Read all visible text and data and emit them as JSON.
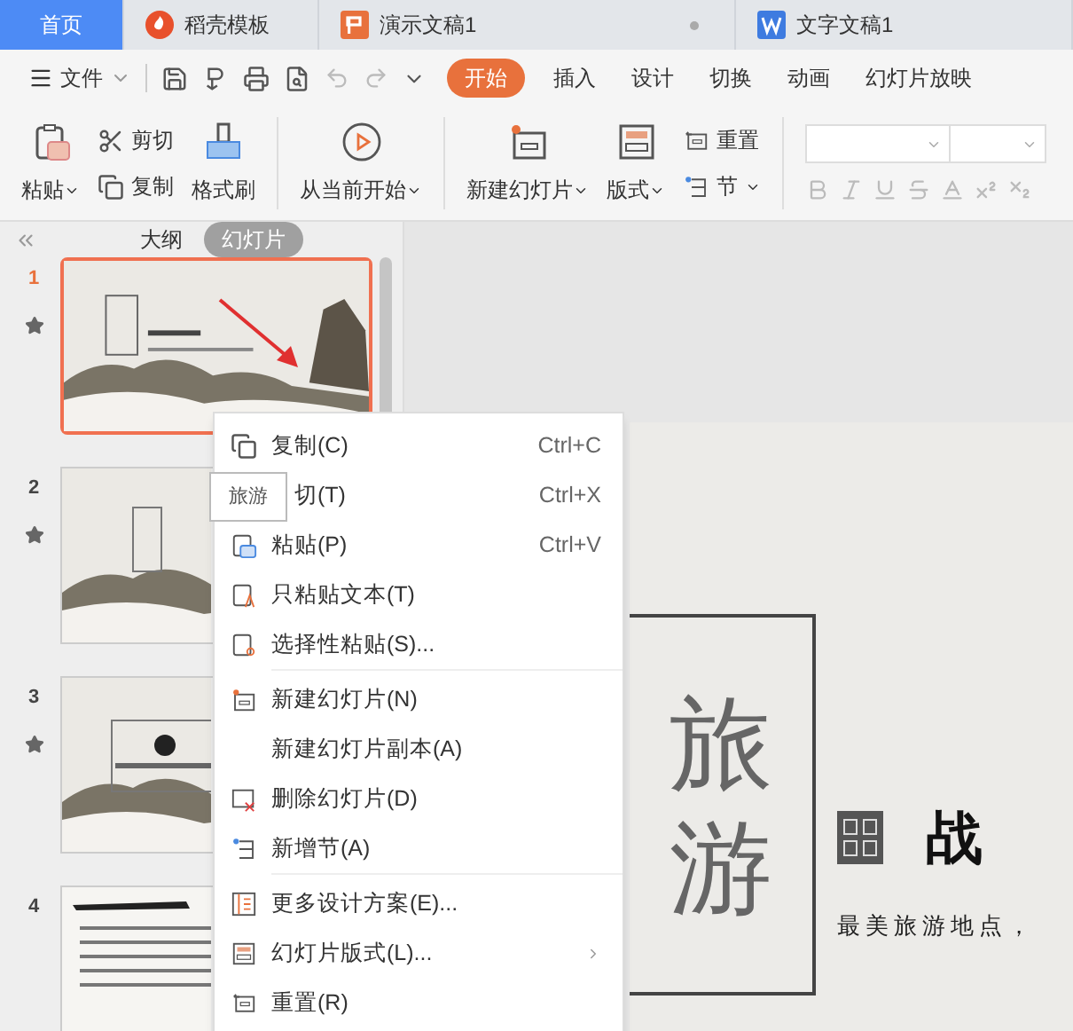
{
  "doc_tabs": [
    {
      "label": "首页",
      "selected": true,
      "kind": "home"
    },
    {
      "label": "稻壳模板",
      "selected": false,
      "kind": "template"
    },
    {
      "label": "演示文稿1",
      "selected": false,
      "kind": "presentation",
      "unsaved": true
    },
    {
      "label": "文字文稿1",
      "selected": false,
      "kind": "writer"
    }
  ],
  "file_menu": {
    "label": "文件"
  },
  "ribbon_tabs": [
    {
      "label": "开始",
      "selected": true
    },
    {
      "label": "插入",
      "selected": false
    },
    {
      "label": "设计",
      "selected": false
    },
    {
      "label": "切换",
      "selected": false
    },
    {
      "label": "动画",
      "selected": false
    },
    {
      "label": "幻灯片放映",
      "selected": false
    }
  ],
  "ribbon_groups": [
    [
      {
        "label": "粘贴",
        "kind": "paste",
        "dropdown": true
      },
      {
        "label": "剪切",
        "kind": "cut",
        "dropdown": false
      },
      {
        "label": "复制",
        "kind": "copy",
        "dropdown": false
      },
      {
        "label": "格式刷",
        "kind": "brush",
        "dropdown": false
      }
    ],
    [
      {
        "label": "从当前开始",
        "kind": "play",
        "dropdown": true
      }
    ],
    [
      {
        "label": "新建幻灯片",
        "kind": "newslide",
        "dropdown": true
      },
      {
        "label": "版式",
        "kind": "layout",
        "dropdown": true
      },
      {
        "label": "重置",
        "kind": "reset",
        "dropdown": false
      },
      {
        "label": "节",
        "kind": "section",
        "dropdown": true
      }
    ]
  ],
  "panel": {
    "tabs": [
      {
        "label": "大纲",
        "selected": false
      },
      {
        "label": "幻灯片",
        "selected": true
      }
    ]
  },
  "slides": [
    {
      "number": "1",
      "selected": true,
      "starred": true,
      "kind": "title"
    },
    {
      "number": "2",
      "selected": false,
      "starred": true,
      "kind": "contents"
    },
    {
      "number": "3",
      "selected": false,
      "starred": true,
      "kind": "section"
    },
    {
      "number": "4",
      "selected": false,
      "starred": false,
      "kind": "text"
    }
  ],
  "context_menu": {
    "groups": [
      [
        {
          "label": "复制(C)",
          "shortcut": "Ctrl+C",
          "kind": "copy"
        },
        {
          "label": "切(T)",
          "shortcut": "Ctrl+X",
          "kind": "covered"
        },
        {
          "label": "粘贴(P)",
          "shortcut": "Ctrl+V",
          "kind": "paste"
        },
        {
          "label": "只粘贴文本(T)",
          "kind": "pastetext"
        },
        {
          "label": "选择性粘贴(S)...",
          "kind": "pastespecial"
        }
      ],
      [
        {
          "label": "新建幻灯片(N)",
          "kind": "newslide"
        },
        {
          "label": "新建幻灯片副本(A)",
          "kind": "none"
        },
        {
          "label": "删除幻灯片(D)",
          "kind": "delete"
        },
        {
          "label": "新增节(A)",
          "kind": "section"
        }
      ],
      [
        {
          "label": "更多设计方案(E)...",
          "kind": "design"
        },
        {
          "label": "幻灯片版式(L)...",
          "kind": "layout",
          "submenu": true
        },
        {
          "label": "重置(R)",
          "kind": "reset"
        }
      ]
    ]
  },
  "tooltip": "旅游",
  "slide_canvas": {
    "title_chars": [
      "旅",
      "游"
    ],
    "heading": "战",
    "subtitle": "最美旅游地点，"
  }
}
